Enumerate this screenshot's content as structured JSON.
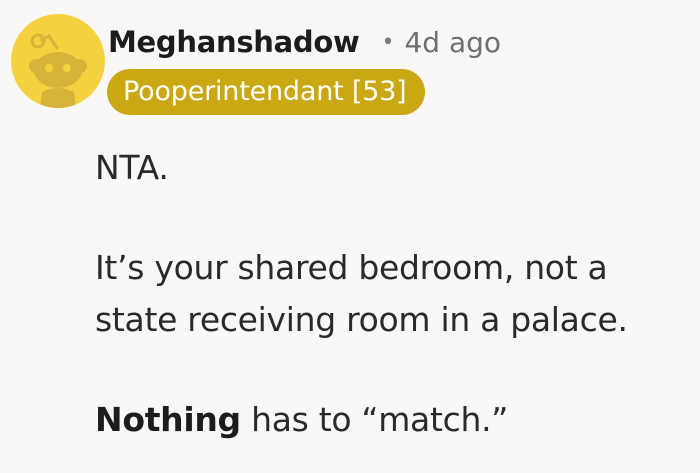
{
  "comment": {
    "username": "Meghanshadow",
    "separator": "•",
    "timestamp": "4d ago",
    "flair": "Pooperintendant [53]",
    "paragraphs": [
      {
        "text": "NTA."
      },
      {
        "line1": "It’s your shared bedroom, not a",
        "line2": "state receiving room in a palace."
      },
      {
        "bold": "Nothing",
        "rest": " has to “match.”"
      }
    ]
  },
  "colors": {
    "background": "#faf8f6",
    "avatar": "#f6d13f",
    "flair_bg": "#c9a813",
    "flair_text": "#ffffff"
  },
  "icons": {
    "avatar": "snoo-avatar-icon"
  }
}
